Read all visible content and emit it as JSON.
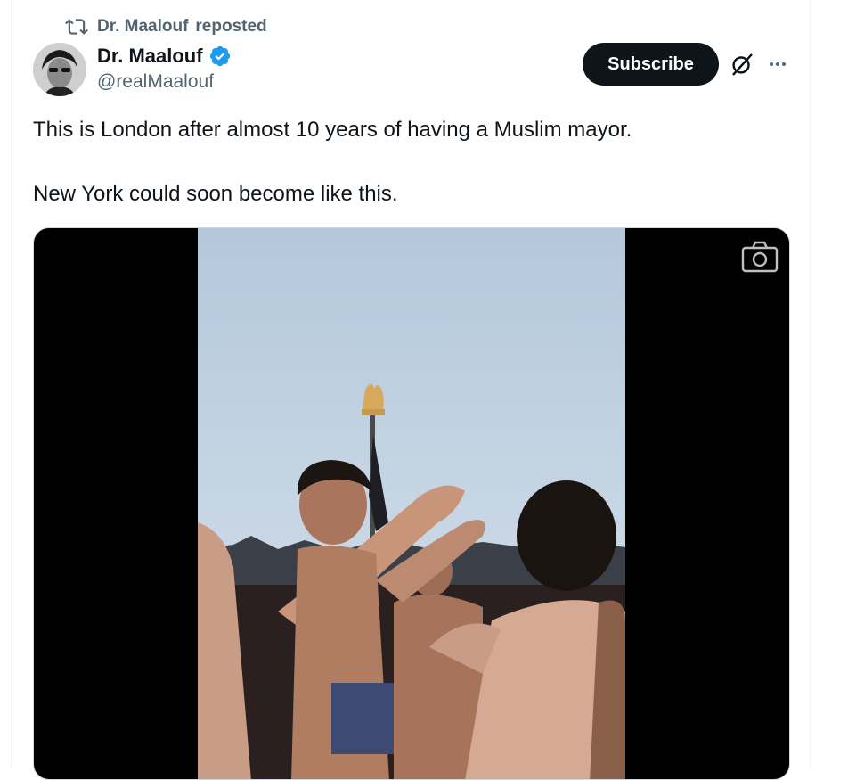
{
  "repost": {
    "name": "Dr. Maalouf",
    "label": "reposted",
    "icon": "repost-icon"
  },
  "author": {
    "display_name": "Dr. Maalouf",
    "handle": "@realMaalouf",
    "verified": true,
    "verified_color": "#1d9bf0"
  },
  "actions": {
    "subscribe_label": "Subscribe",
    "grok_icon": "grok-icon",
    "more_icon": "more-icon"
  },
  "tweet": {
    "lines": [
      "This is London after almost 10 years of having a Muslim mayor.",
      "New York could soon become like this."
    ]
  },
  "media": {
    "type": "video",
    "camera_icon": "camera-icon"
  },
  "colors": {
    "text_primary": "#0f1419",
    "text_secondary": "#536471",
    "button_bg": "#0f1419",
    "border": "#cfd9de"
  }
}
